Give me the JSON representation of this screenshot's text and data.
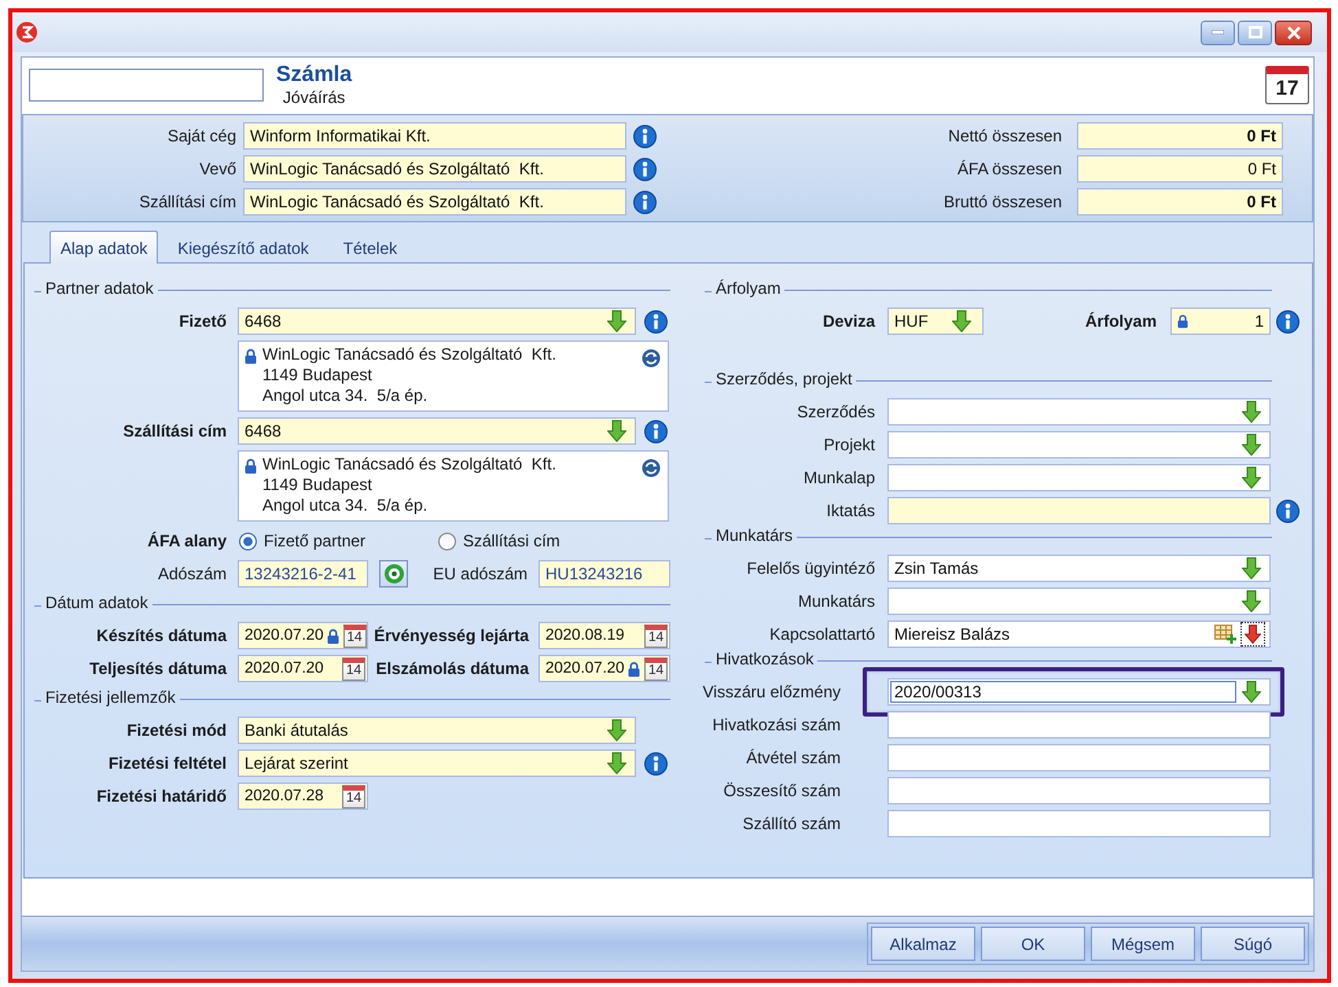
{
  "header": {
    "title": "Számla",
    "subtitle": "Jóváírás",
    "calendar_day": "17"
  },
  "summary": {
    "parties": [
      {
        "label": "Saját cég",
        "value": "Winform Informatikai Kft.",
        "info": true
      },
      {
        "label": "Vevő",
        "value": "WinLogic Tanácsadó és Szolgáltató  Kft.",
        "info": true
      },
      {
        "label": "Szállítási cím",
        "value": "WinLogic Tanácsadó és Szolgáltató  Kft.",
        "info": true
      }
    ],
    "totals": [
      {
        "label": "Nettó összesen",
        "value": "0 Ft",
        "bold": true
      },
      {
        "label": "ÁFA összesen",
        "value": "0 Ft",
        "bold": false
      },
      {
        "label": "Bruttó összesen",
        "value": "0 Ft",
        "bold": true
      }
    ]
  },
  "tabs": [
    {
      "label": "Alap adatok",
      "selected": true
    },
    {
      "label": "Kiegészítő adatok",
      "selected": false
    },
    {
      "label": "Tételek",
      "selected": false
    }
  ],
  "left_sections": [
    {
      "title": "Partner adatok",
      "rows": [
        {
          "kind": "combo",
          "label": "Fizető",
          "required": true,
          "value": "6468",
          "shaded": true,
          "info": true
        },
        {
          "kind": "address",
          "locked": true,
          "lines": [
            "WinLogic Tanácsadó és Szolgáltató  Kft.",
            "1149 Budapest",
            "Angol utca 34.  5/a ép."
          ]
        },
        {
          "kind": "combo",
          "label": "Szállítási cím",
          "required": true,
          "value": "6468",
          "shaded": true,
          "info": true
        },
        {
          "kind": "address",
          "locked": true,
          "lines": [
            "WinLogic Tanácsadó és Szolgáltató  Kft.",
            "1149 Budapest",
            "Angol utca 34.  5/a ép."
          ]
        },
        {
          "kind": "radio",
          "label": "ÁFA alany",
          "required": true,
          "options": [
            {
              "label": "Fizető partner",
              "selected": true
            },
            {
              "label": "Szállítási cím",
              "selected": false
            }
          ]
        },
        {
          "kind": "tax",
          "items": [
            {
              "label": "Adószám",
              "required": false,
              "value": "13243216-2-41",
              "shaded": true
            },
            {
              "label": "EU adószám",
              "required": false,
              "value": "HU13243216",
              "shaded": true
            }
          ]
        }
      ]
    },
    {
      "title": "Dátum adatok",
      "rows": [
        {
          "kind": "dates",
          "items": [
            {
              "label": "Készítés dátuma",
              "required": true,
              "value": "2020.07.20",
              "locked": true,
              "calendar": "14"
            },
            {
              "label": "Érvényesség lejárta",
              "required": true,
              "value": "2020.08.19",
              "locked": false,
              "calendar": "14"
            }
          ]
        },
        {
          "kind": "dates",
          "items": [
            {
              "label": "Teljesítés dátuma",
              "required": true,
              "value": "2020.07.20",
              "locked": false,
              "calendar": "14"
            },
            {
              "label": "Elszámolás dátuma",
              "required": true,
              "value": "2020.07.20",
              "locked": true,
              "calendar": "14"
            }
          ]
        }
      ]
    },
    {
      "title": "Fizetési jellemzők",
      "rows": [
        {
          "kind": "combo",
          "label": "Fizetési mód",
          "required": true,
          "value": "Banki átutalás",
          "shaded": true,
          "info": false
        },
        {
          "kind": "combo",
          "label": "Fizetési feltétel",
          "required": true,
          "value": "Lejárat szerint",
          "shaded": true,
          "info": true
        },
        {
          "kind": "dates",
          "items": [
            {
              "label": "Fizetési határidő",
              "required": true,
              "value": "2020.07.28",
              "locked": false,
              "calendar": "14"
            }
          ]
        }
      ]
    }
  ],
  "right_sections": [
    {
      "title": "Árfolyam",
      "rows": [
        {
          "kind": "currency",
          "label": "Deviza",
          "required": true,
          "value": "HUF",
          "shaded": true,
          "rate": {
            "label": "Árfolyam",
            "required": true,
            "value": "1",
            "locked": true,
            "shaded": true
          },
          "info": true
        }
      ]
    },
    {
      "title": "Szerződés, projekt",
      "rows": [
        {
          "kind": "combo",
          "label": "Szerződés",
          "required": false,
          "shaded": false,
          "info": false
        },
        {
          "kind": "combo",
          "label": "Projekt",
          "required": false,
          "shaded": false,
          "info": false
        },
        {
          "kind": "combo",
          "label": "Munkalap",
          "required": false,
          "shaded": false,
          "info": false
        },
        {
          "kind": "text",
          "label": "Iktatás",
          "required": false,
          "shaded": true,
          "info": true
        }
      ]
    },
    {
      "title": "Munkatárs",
      "rows": [
        {
          "kind": "combo",
          "label": "Felelős ügyintéző",
          "required": false,
          "value": "Zsin Tamás",
          "shaded": false,
          "info": false
        },
        {
          "kind": "combo",
          "label": "Munkatárs",
          "required": false,
          "shaded": false,
          "info": false
        },
        {
          "kind": "contact",
          "label": "Kapcsolattartó",
          "required": false,
          "value": "Miereisz Balázs",
          "shaded": false
        }
      ]
    },
    {
      "title": "Hivatkozások",
      "rows": [
        {
          "kind": "combo",
          "label": "Visszáru előzmény",
          "required": false,
          "value": "2020/00313",
          "shaded": false,
          "info": false,
          "focused": true,
          "highlighted": true
        },
        {
          "kind": "text",
          "label": "Hivatkozási szám",
          "required": false,
          "shaded": false,
          "info": false
        },
        {
          "kind": "text",
          "label": "Átvétel szám",
          "required": false,
          "shaded": false,
          "info": false
        },
        {
          "kind": "text",
          "label": "Összesítő szám",
          "required": false,
          "shaded": false,
          "info": false
        },
        {
          "kind": "text",
          "label": "Szállító szám",
          "required": false,
          "shaded": false,
          "info": false
        }
      ]
    }
  ],
  "buttons": [
    "Alkalmaz",
    "OK",
    "Mégsem",
    "Súgó"
  ]
}
